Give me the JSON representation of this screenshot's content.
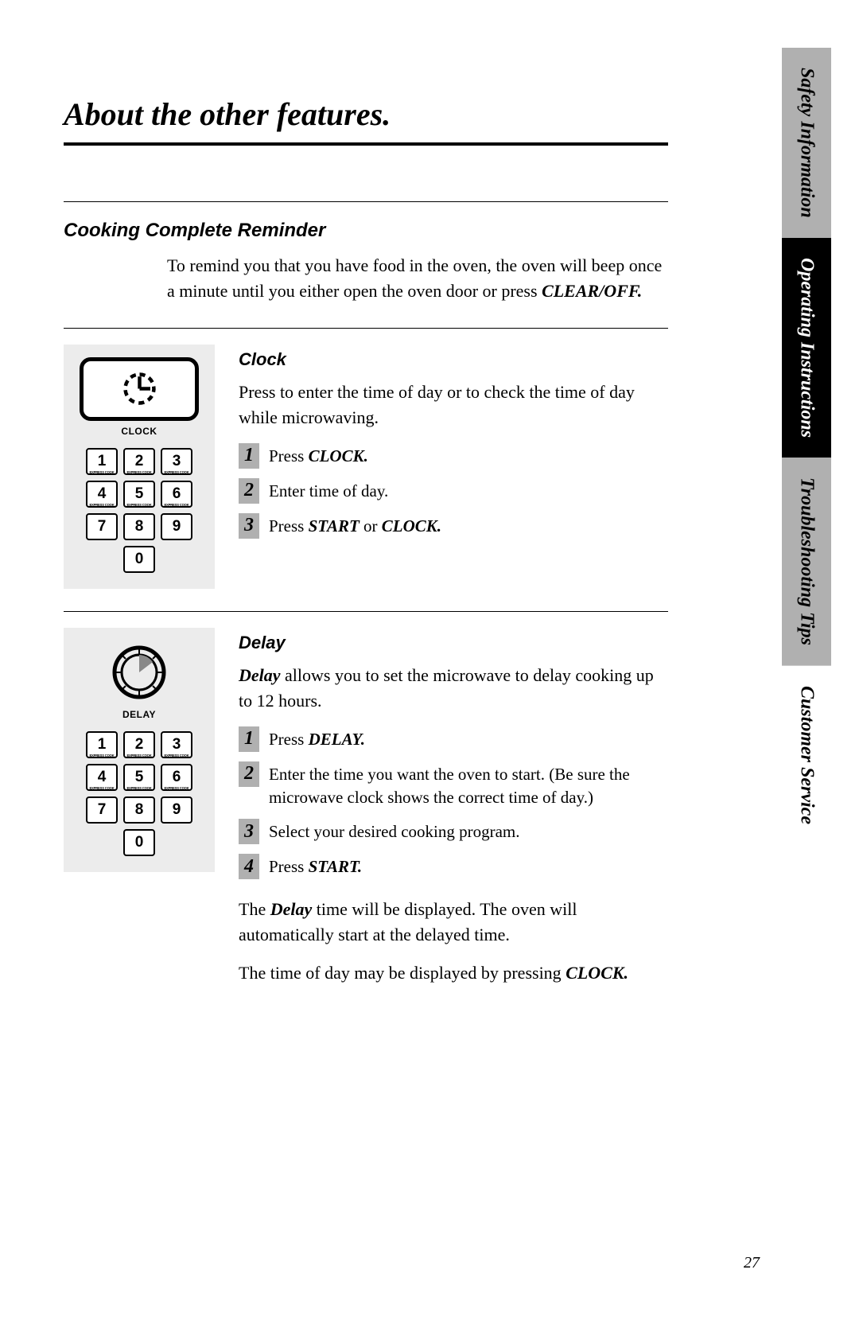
{
  "page_number": "27",
  "page_title": "About the other features.",
  "side_tabs": [
    {
      "label": "Safety Information",
      "style": "gray"
    },
    {
      "label": "Operating Instructions",
      "style": "black"
    },
    {
      "label": "Troubleshooting Tips",
      "style": "gray"
    },
    {
      "label": "Customer Service",
      "style": "white"
    }
  ],
  "sections": {
    "reminder": {
      "heading": "Cooking Complete Reminder",
      "body_pre": "To remind you that you have food in the oven, the oven will beep once a minute until you either open the oven door or press ",
      "body_bold": "CLEAR/OFF."
    },
    "clock": {
      "heading": "Clock",
      "body": "Press to enter the time of day or to check the time of day while microwaving.",
      "panel_label": "CLOCK",
      "steps": [
        {
          "n": "1",
          "pre": "Press ",
          "b1": "CLOCK.",
          "mid": "",
          "b2": "",
          "post": ""
        },
        {
          "n": "2",
          "pre": "Enter time of day.",
          "b1": "",
          "mid": "",
          "b2": "",
          "post": ""
        },
        {
          "n": "3",
          "pre": "Press ",
          "b1": "START",
          "mid": " or ",
          "b2": "CLOCK.",
          "post": ""
        }
      ]
    },
    "delay": {
      "heading": "Delay",
      "body_bold": "Delay",
      "body_post": " allows you to set the microwave to delay cooking up to 12 hours.",
      "panel_label": "DELAY",
      "steps": [
        {
          "n": "1",
          "pre": "Press ",
          "b1": "DELAY.",
          "mid": "",
          "b2": "",
          "post": ""
        },
        {
          "n": "2",
          "pre": "Enter the time you want the oven to start. (Be sure the microwave clock shows the correct time of day.)",
          "b1": "",
          "mid": "",
          "b2": "",
          "post": ""
        },
        {
          "n": "3",
          "pre": "Select your desired cooking program.",
          "b1": "",
          "mid": "",
          "b2": "",
          "post": ""
        },
        {
          "n": "4",
          "pre": "Press ",
          "b1": "START.",
          "mid": "",
          "b2": "",
          "post": ""
        }
      ],
      "after1_pre": "The ",
      "after1_bold": "Delay",
      "after1_post": " time will be displayed. The oven will automatically start at the delayed time.",
      "after2_pre": "The time of day may be displayed by pressing ",
      "after2_bold": "CLOCK."
    }
  },
  "keypad": {
    "keys": [
      "1",
      "2",
      "3",
      "4",
      "5",
      "6",
      "7",
      "8",
      "9",
      "0"
    ],
    "sublabel": "EXPRESS COOK"
  }
}
